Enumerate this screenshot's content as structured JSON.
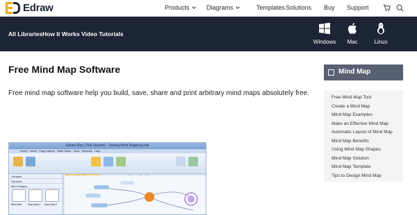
{
  "brand": {
    "name": "Edraw"
  },
  "topnav": {
    "items": [
      "Products",
      "Diagrams",
      "Templates",
      "Solutions",
      "Buy",
      "Support"
    ]
  },
  "subnav": {
    "links": [
      "All Libraries",
      "How It Works",
      "Video Tutorials"
    ],
    "platforms": [
      "Windows",
      "Mac",
      "Linux"
    ]
  },
  "main": {
    "title": "Free Mind Map Software",
    "intro": "Free mind map software help you build, save, share and print arbitrary mind maps absolutely free."
  },
  "screenshot": {
    "window_title": "Edraw Max (Trial Version) - Desing Mind Mapping.edx",
    "ribbon_tabs": [
      "Home",
      "Insert",
      "Page Layout",
      "Slide Show",
      "View",
      "Symbols",
      "Help"
    ],
    "sidebar_rows": [
      "Libraries",
      "Symbols",
      "Mind Shapes"
    ],
    "thumb_labels": [
      "Main Idea",
      "Main Idea 2",
      "Main Idea 2"
    ],
    "doc_tabs": [
      "Desing Mind Mapping.edx",
      "mind map template.Cedx",
      "Start Page"
    ]
  },
  "sidebar": {
    "heading": "Mind Map",
    "items": [
      "Free Mind Map Tool",
      "Create a Mind Map",
      "Mind Map Examples",
      "Make an Effective Mind Map",
      "Automatic Layout of Mind Map",
      "Mind Map Benefits",
      "Using Mind Map Shapes",
      "Mind Map Solution",
      "Mind Map Template",
      "Tips to Design Mind Map"
    ]
  },
  "colors": {
    "accent": "#f0a820",
    "dark_bar": "#1c2536",
    "sidebar_head": "#586172"
  }
}
